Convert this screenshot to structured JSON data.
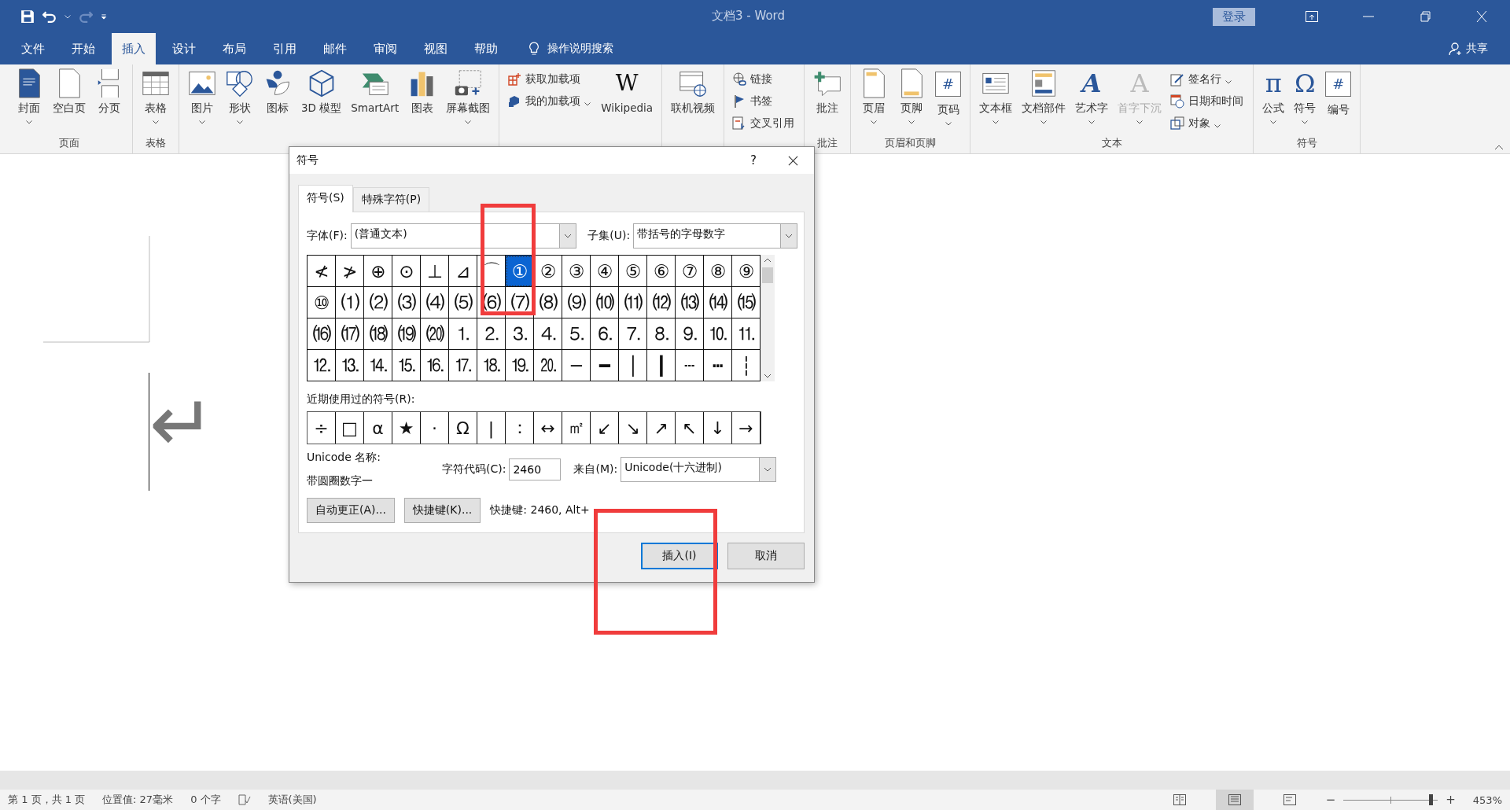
{
  "window": {
    "title": "文档3 - Word",
    "sign_in": "登录"
  },
  "quick_access": [
    {
      "disabled": false
    },
    {
      "disabled": false
    },
    {
      "disabled": true
    }
  ],
  "tabs": [
    {
      "label": "文件",
      "selected": false
    },
    {
      "label": "开始",
      "selected": false
    },
    {
      "label": "插入",
      "selected": true
    },
    {
      "label": "设计",
      "selected": false
    },
    {
      "label": "布局",
      "selected": false
    },
    {
      "label": "引用",
      "selected": false
    },
    {
      "label": "邮件",
      "selected": false
    },
    {
      "label": "审阅",
      "selected": false
    },
    {
      "label": "视图",
      "selected": false
    },
    {
      "label": "帮助",
      "selected": false
    }
  ],
  "tell_me": "操作说明搜索",
  "share": "共享",
  "ribbon": [
    {
      "label": "页面",
      "items": [
        {
          "kind": "large",
          "label": "封面",
          "dropdown": true,
          "disabled": false
        },
        {
          "kind": "large",
          "label": "空白页",
          "dropdown": false,
          "disabled": false
        },
        {
          "kind": "large",
          "label": "分页",
          "dropdown": false,
          "disabled": false
        }
      ]
    },
    {
      "label": "表格",
      "items": [
        {
          "kind": "large",
          "label": "表格",
          "dropdown": true,
          "disabled": false
        }
      ]
    },
    {
      "items": [
        {
          "kind": "large",
          "label": "图片",
          "dropdown": true,
          "disabled": false
        },
        {
          "kind": "large",
          "label": "形状",
          "dropdown": true,
          "disabled": false
        },
        {
          "kind": "large",
          "label": "图标",
          "dropdown": false,
          "disabled": false
        },
        {
          "kind": "large",
          "label": "3D 模型",
          "dropdown": false,
          "disabled": false
        },
        {
          "kind": "large",
          "label": "SmartArt",
          "dropdown": false,
          "disabled": false
        },
        {
          "kind": "large",
          "label": "图表",
          "dropdown": false,
          "disabled": false
        },
        {
          "kind": "large",
          "label": "屏幕截图",
          "dropdown": true,
          "disabled": false
        }
      ]
    },
    {
      "items": [
        {
          "kind": "small",
          "label": "获取加载项",
          "dropdown": false,
          "disabled": false
        },
        {
          "kind": "small",
          "label": "我的加载项",
          "dropdown": true,
          "disabled": false
        },
        {
          "kind": "large",
          "label": "Wikipedia",
          "glyph": "W",
          "dropdown": false,
          "disabled": false
        }
      ]
    },
    {
      "items": [
        {
          "kind": "large",
          "label": "联机视频",
          "dropdown": false,
          "disabled": false
        }
      ]
    },
    {
      "items": [
        {
          "kind": "small",
          "label": "链接",
          "dropdown": false,
          "disabled": false
        },
        {
          "kind": "small",
          "label": "书签",
          "dropdown": false,
          "disabled": false
        },
        {
          "kind": "small",
          "label": "交叉引用",
          "dropdown": false,
          "disabled": false
        }
      ]
    },
    {
      "label": "批注",
      "items": [
        {
          "kind": "large",
          "label": "批注",
          "dropdown": false,
          "disabled": false
        }
      ]
    },
    {
      "label": "页眉和页脚",
      "items": [
        {
          "kind": "large",
          "label": "页眉",
          "dropdown": true,
          "disabled": false
        },
        {
          "kind": "large",
          "label": "页脚",
          "dropdown": true,
          "disabled": false
        },
        {
          "kind": "large",
          "label": "页码",
          "glyph": "#",
          "dropdown": true,
          "disabled": false
        }
      ]
    },
    {
      "label": "文本",
      "items": [
        {
          "kind": "large",
          "label": "文本框",
          "dropdown": true,
          "disabled": false
        },
        {
          "kind": "large",
          "label": "文档部件",
          "dropdown": true,
          "disabled": false
        },
        {
          "kind": "large",
          "label": "艺术字",
          "glyph": "A",
          "dropdown": true,
          "disabled": false
        },
        {
          "kind": "large",
          "label": "首字下沉",
          "glyph": "A",
          "dropdown": true,
          "disabled": true
        },
        {
          "kind": "small",
          "label": "签名行",
          "dropdown": true,
          "disabled": false
        },
        {
          "kind": "small",
          "label": "日期和时间",
          "dropdown": false,
          "disabled": false
        },
        {
          "kind": "small",
          "label": "对象",
          "dropdown": true,
          "disabled": false
        }
      ]
    },
    {
      "label": "符号",
      "items": [
        {
          "kind": "large",
          "label": "公式",
          "glyph": "π",
          "dropdown": true,
          "disabled": false
        },
        {
          "kind": "large",
          "label": "符号",
          "glyph": "Ω",
          "dropdown": true,
          "disabled": false
        },
        {
          "kind": "large",
          "label": "编号",
          "glyph": "#",
          "dropdown": false,
          "disabled": false
        }
      ]
    }
  ],
  "document": {
    "paragraph_mark": "↵"
  },
  "dialog": {
    "title": "符号",
    "help": "?",
    "tabs": [
      {
        "label": "符号(S)",
        "selected": true
      },
      {
        "label": "特殊字符(P)",
        "selected": false
      }
    ],
    "font_label": "字体(F):",
    "font_value": "(普通文本)",
    "subset_label": "子集(U):",
    "subset_value": "带括号的字母数字",
    "symbols": [
      [
        {
          "char": "≮",
          "selected": false
        },
        {
          "char": "≯",
          "selected": false
        },
        {
          "char": "⊕",
          "selected": false
        },
        {
          "char": "⊙",
          "selected": false
        },
        {
          "char": "⊥",
          "selected": false
        },
        {
          "char": "⊿",
          "selected": false
        },
        {
          "char": "⌒",
          "selected": false
        },
        {
          "char": "①",
          "selected": true
        },
        {
          "char": "②",
          "selected": false
        },
        {
          "char": "③",
          "selected": false
        },
        {
          "char": "④",
          "selected": false
        },
        {
          "char": "⑤",
          "selected": false
        },
        {
          "char": "⑥",
          "selected": false
        },
        {
          "char": "⑦",
          "selected": false
        },
        {
          "char": "⑧",
          "selected": false
        },
        {
          "char": "⑨",
          "selected": false
        }
      ],
      [
        {
          "char": "⑩",
          "selected": false
        },
        {
          "char": "⑴",
          "selected": false
        },
        {
          "char": "⑵",
          "selected": false
        },
        {
          "char": "⑶",
          "selected": false
        },
        {
          "char": "⑷",
          "selected": false
        },
        {
          "char": "⑸",
          "selected": false
        },
        {
          "char": "⑹",
          "selected": false
        },
        {
          "char": "⑺",
          "selected": false
        },
        {
          "char": "⑻",
          "selected": false
        },
        {
          "char": "⑼",
          "selected": false
        },
        {
          "char": "⑽",
          "selected": false
        },
        {
          "char": "⑾",
          "selected": false
        },
        {
          "char": "⑿",
          "selected": false
        },
        {
          "char": "⒀",
          "selected": false
        },
        {
          "char": "⒁",
          "selected": false
        },
        {
          "char": "⒂",
          "selected": false
        }
      ],
      [
        {
          "char": "⒃",
          "selected": false
        },
        {
          "char": "⒄",
          "selected": false
        },
        {
          "char": "⒅",
          "selected": false
        },
        {
          "char": "⒆",
          "selected": false
        },
        {
          "char": "⒇",
          "selected": false
        },
        {
          "char": "⒈",
          "selected": false
        },
        {
          "char": "⒉",
          "selected": false
        },
        {
          "char": "⒊",
          "selected": false
        },
        {
          "char": "⒋",
          "selected": false
        },
        {
          "char": "⒌",
          "selected": false
        },
        {
          "char": "⒍",
          "selected": false
        },
        {
          "char": "⒎",
          "selected": false
        },
        {
          "char": "⒏",
          "selected": false
        },
        {
          "char": "⒐",
          "selected": false
        },
        {
          "char": "⒑",
          "selected": false
        },
        {
          "char": "⒒",
          "selected": false
        }
      ],
      [
        {
          "char": "⒓",
          "selected": false
        },
        {
          "char": "⒔",
          "selected": false
        },
        {
          "char": "⒕",
          "selected": false
        },
        {
          "char": "⒖",
          "selected": false
        },
        {
          "char": "⒗",
          "selected": false
        },
        {
          "char": "⒘",
          "selected": false
        },
        {
          "char": "⒙",
          "selected": false
        },
        {
          "char": "⒚",
          "selected": false
        },
        {
          "char": "⒛",
          "selected": false
        },
        {
          "char": "─",
          "selected": false
        },
        {
          "char": "━",
          "selected": false
        },
        {
          "char": "│",
          "selected": false
        },
        {
          "char": "┃",
          "selected": false
        },
        {
          "char": "┄",
          "selected": false
        },
        {
          "char": "┅",
          "selected": false
        },
        {
          "char": "┆",
          "selected": false
        }
      ]
    ],
    "recent_label": "近期使用过的符号(R):",
    "recent": [
      "÷",
      "□",
      "α",
      "★",
      "·",
      "Ω",
      "|",
      "：",
      "↔",
      "㎡",
      "↙",
      "↘",
      "↗",
      "↖",
      "↓",
      "→"
    ],
    "unicode_name_label": "Unicode 名称:",
    "unicode_name": "带圆圈数字一",
    "code_label": "字符代码(C):",
    "code_value": "2460",
    "from_label": "来自(M):",
    "from_value": "Unicode(十六进制)",
    "autocorrect_button": "自动更正(A)...",
    "shortcut_button": "快捷键(K)...",
    "shortcut_text": "快捷键: 2460, Alt+",
    "insert_button": "插入(I)",
    "cancel_button": "取消"
  },
  "status_bar": {
    "page": "第 1 页，共 1 页",
    "position": "位置值: 27毫米",
    "words": "0 个字",
    "language": "英语(美国)",
    "views": [
      {
        "selected": false
      },
      {
        "selected": true
      },
      {
        "selected": false
      }
    ],
    "zoom_out": "−",
    "zoom_in": "+",
    "zoom": {
      "level": 0.93
    },
    "zoom_value": "453%"
  }
}
